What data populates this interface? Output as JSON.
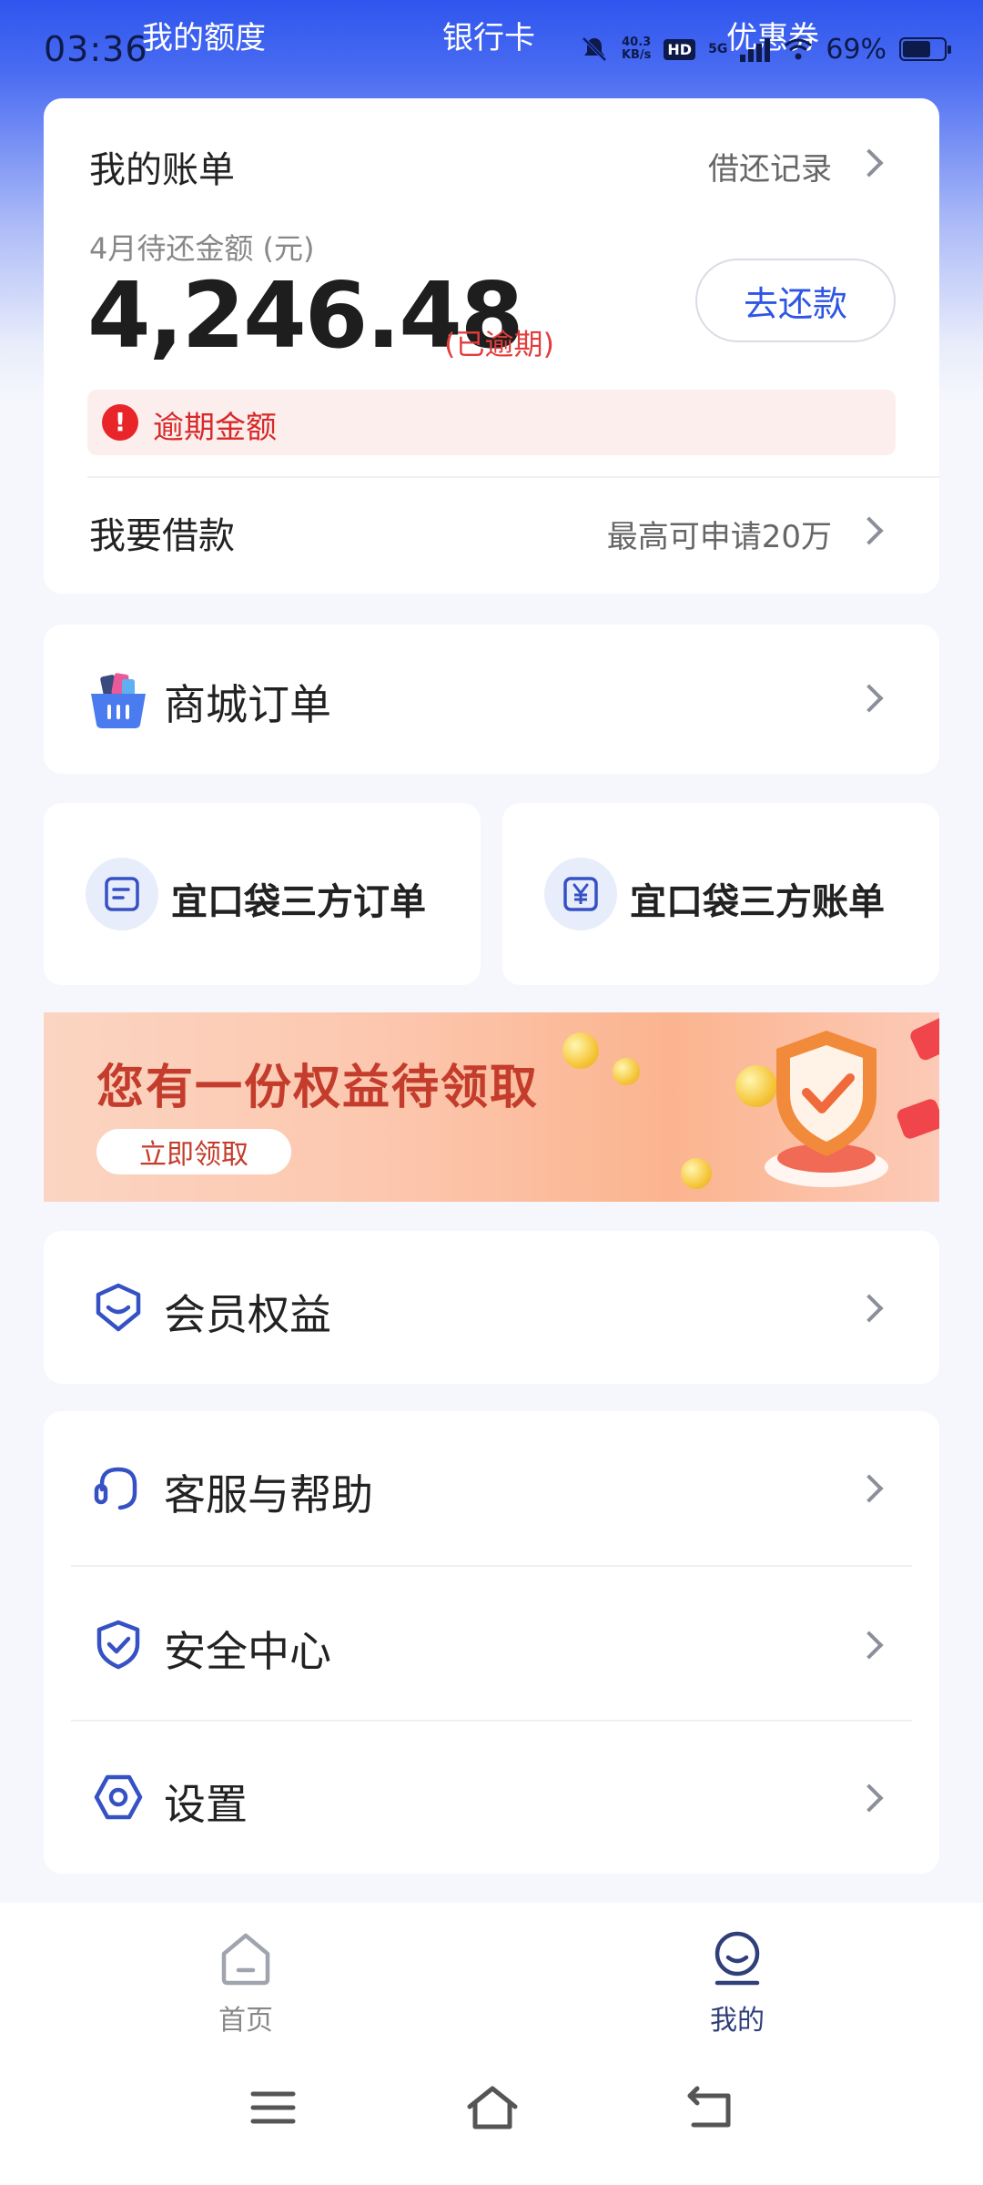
{
  "status_bar": {
    "time": "03:36",
    "net_speed_value": "40.3",
    "net_speed_unit": "KB/s",
    "hd_label": "HD",
    "signal_label": "5G",
    "battery": "69%",
    "battery_level": 0.69
  },
  "top_tabs": [
    "我的额度",
    "银行卡",
    "优惠券"
  ],
  "bill": {
    "title": "我的账单",
    "records_link": "借还记录",
    "period_label": "4月待还金额 (元)",
    "amount": "4,246.48",
    "status": "(已逾期)",
    "repay_button": "去还款",
    "overdue_label": "逾期金额",
    "loan_title": "我要借款",
    "loan_subtitle": "最高可申请20万"
  },
  "mall_orders": {
    "label": "商城订单"
  },
  "third_party": {
    "orders": "宜口袋三方订单",
    "bills": "宜口袋三方账单"
  },
  "banner": {
    "title": "您有一份权益待领取",
    "button": "立即领取"
  },
  "membership": {
    "label": "会员权益"
  },
  "menu": {
    "items": [
      {
        "label": "客服与帮助",
        "icon": "headset-icon"
      },
      {
        "label": "安全中心",
        "icon": "shield-icon"
      },
      {
        "label": "设置",
        "icon": "settings-icon"
      }
    ]
  },
  "bottom_nav": {
    "home": "首页",
    "mine": "我的",
    "active": "mine",
    "active_color": "#2f3f7a",
    "inactive_color": "#888888"
  },
  "colors": {
    "brand_blue": "#2f55e4",
    "danger_red": "#e23c3c"
  }
}
